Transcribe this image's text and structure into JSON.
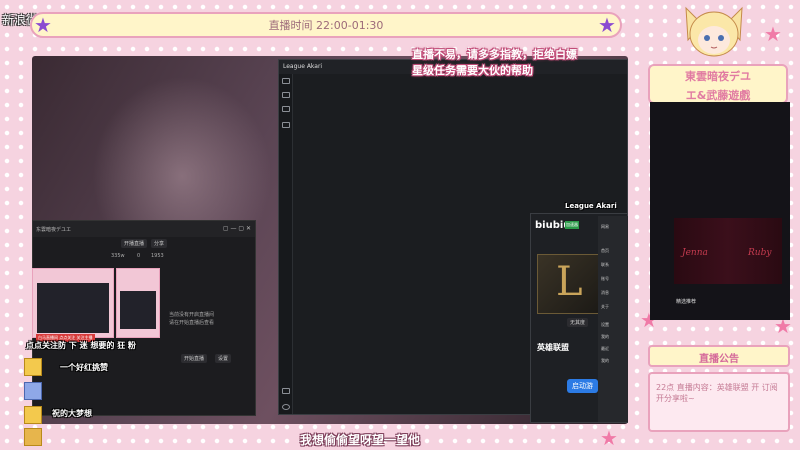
{
  "overlay": {
    "weibo": "新浪微博：東雲暗夜、武藤遊戲",
    "stream_time": "直播时间 22:00-01:30",
    "top_line1": "直播不易，请多多指教，拒绝白嫖",
    "top_line2": "星级任务需要大伙的帮助",
    "bottom_line": "我想偷偷望呀望一望他",
    "left_ov1": "点点关注防 下 迷 想要的 狂 粉 ",
    "left_ov2": "一个好红挑赞",
    "left_ov3": "祝的大梦想",
    "left_red": "白马直播间 点点关注 关注主播"
  },
  "akari": {
    "title": "League Akari",
    "label": "League Akari"
  },
  "douyu_window": {
    "title": "东雲暗夜デユエ",
    "btn_open": "开播直播",
    "btn_share": "分享",
    "stat1": "335w",
    "stat2": "0",
    "stat3": "1953",
    "row1": "当前没有开启直播间",
    "row2": "请在开始直播后查看",
    "btn_start": "开始直播",
    "btn_settings": "设置"
  },
  "biubiu": {
    "logo": "biubiu",
    "badge": "加速器",
    "game_name": "英雄联盟",
    "launch": "启动游",
    "tag": "无其度",
    "menu": [
      "网易",
      "首页",
      "联系",
      "账号",
      "消息",
      "关于",
      "设置",
      "我的",
      "最近",
      "我的"
    ]
  },
  "right_panel": {
    "brand_line1": "東雲暗夜デユ",
    "brand_line2": "エ&武藤遊戲",
    "name1": "Jenna",
    "name2": "Ruby",
    "rec_label": "精选推荐",
    "notice_title": "直播公告",
    "notice_body": "22点 直播内容：英雄联盟 开 订阅 开分享啦~"
  },
  "icons": [
    "star-icon",
    "window-close-icon",
    "avatar-icon",
    "gift-icon"
  ]
}
